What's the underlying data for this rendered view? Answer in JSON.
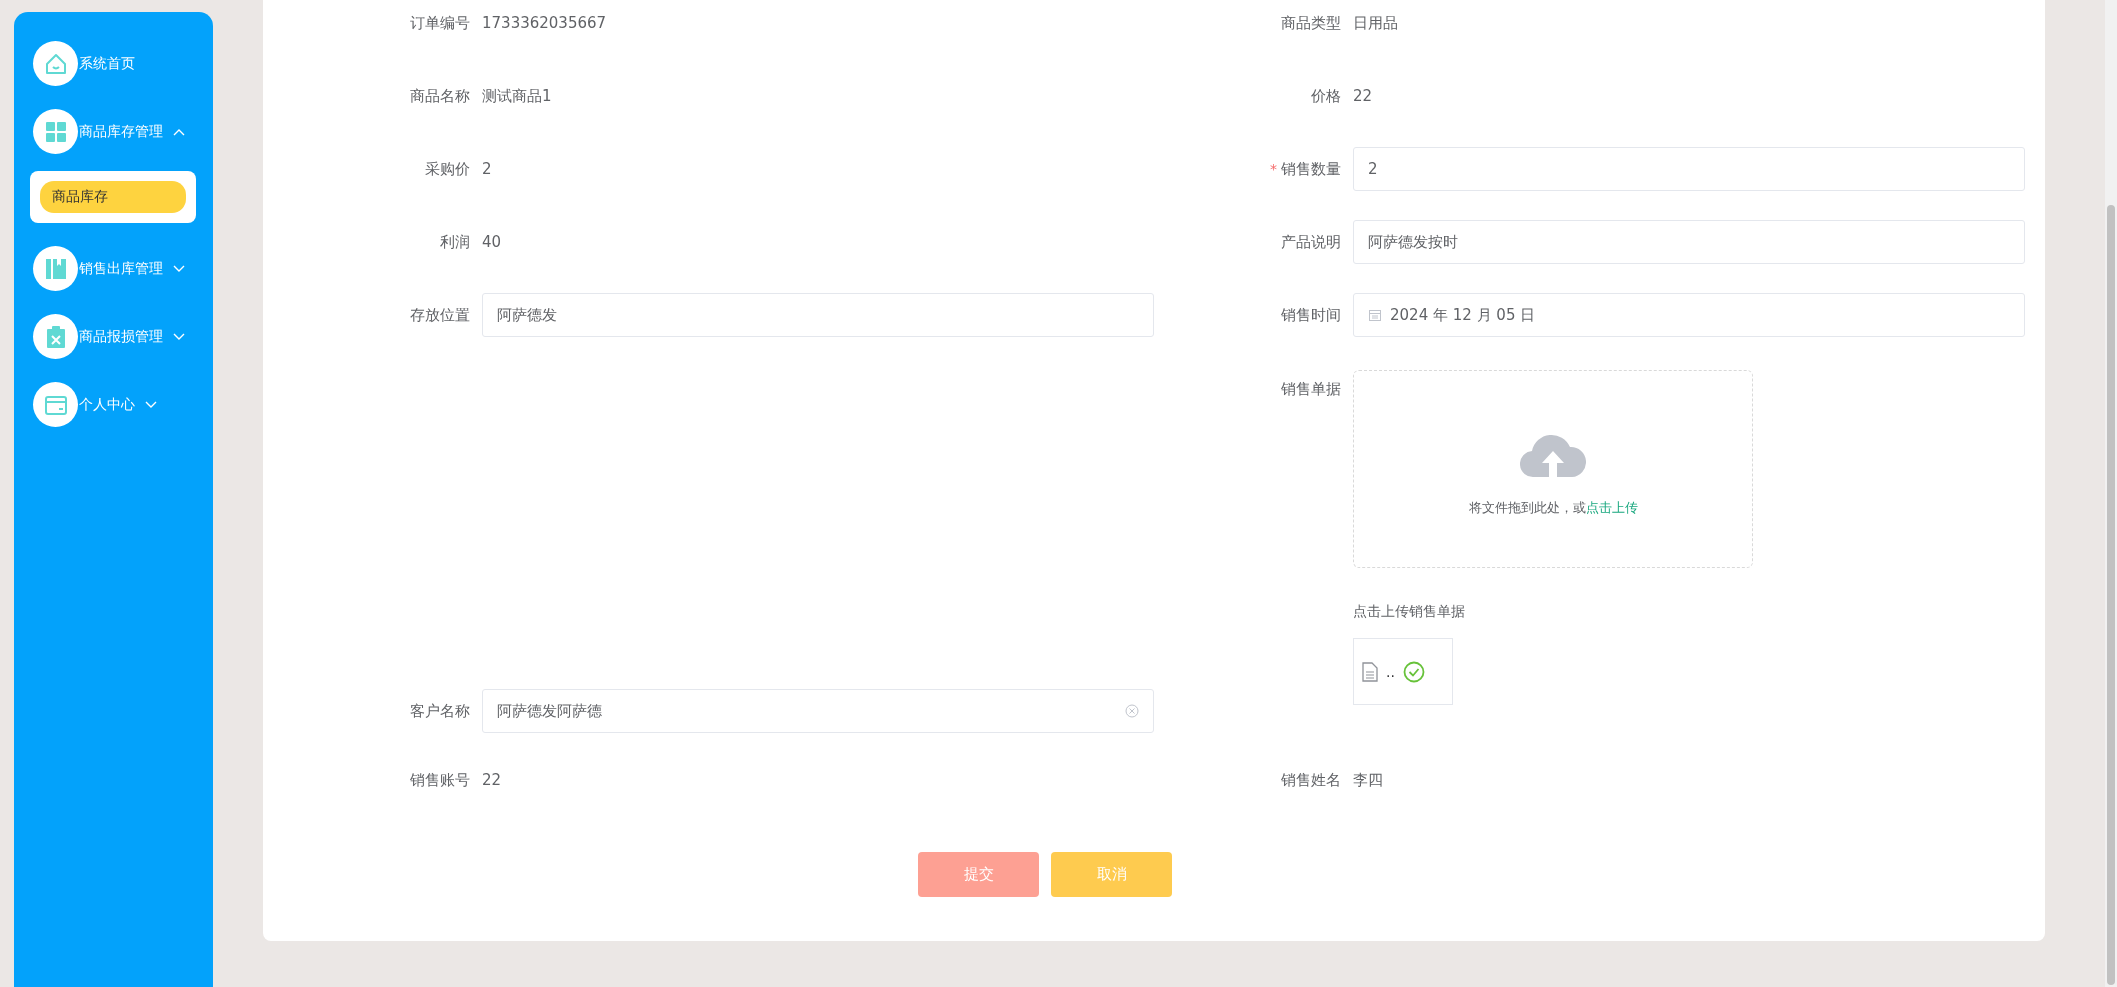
{
  "sidebar": {
    "items": [
      {
        "kind": "link",
        "label": "系统首页"
      },
      {
        "kind": "group",
        "label": "商品库存管理",
        "expanded": true,
        "children": [
          {
            "label": "商品库存",
            "selected": true
          }
        ]
      },
      {
        "kind": "group",
        "label": "销售出库管理",
        "expanded": false
      },
      {
        "kind": "group",
        "label": "商品报损管理",
        "expanded": false
      },
      {
        "kind": "group",
        "label": "个人中心",
        "expanded": false
      }
    ]
  },
  "form": {
    "rows": [
      [
        {
          "label": "订单编号",
          "kind": "text",
          "value": "1733362035667"
        },
        {
          "label": "商品类型",
          "kind": "text",
          "value": "日用品"
        }
      ],
      [
        {
          "label": "商品名称",
          "kind": "text",
          "value": "测试商品1"
        },
        {
          "label": "价格",
          "kind": "text",
          "value": "22"
        }
      ],
      [
        {
          "label": "采购价",
          "kind": "text",
          "value": "2"
        },
        {
          "label": "销售数量",
          "kind": "input",
          "value": "2",
          "required_mark": "*"
        }
      ],
      [
        {
          "label": "利润",
          "kind": "text",
          "value": "40"
        },
        {
          "label": "产品说明",
          "kind": "input",
          "value": "阿萨德发按时"
        }
      ],
      [
        {
          "label": "存放位置",
          "kind": "input",
          "value": "阿萨德发"
        },
        {
          "label": "销售时间",
          "kind": "date",
          "value": "2024 年 12 月 05 日"
        }
      ],
      [
        {
          "label": "客户名称",
          "kind": "input",
          "value": "阿萨德发阿萨德",
          "clearable": true
        },
        {
          "label": "销售单据",
          "kind": "upload",
          "prompt": "将文件拖到此处，或",
          "link": "点击上传",
          "tip": "点击上传销售单据",
          "files": [
            {
              "name": "..",
              "uploaded": true
            }
          ]
        }
      ],
      [
        {
          "label": "销售账号",
          "kind": "text",
          "value": "22"
        },
        {
          "label": "销售姓名",
          "kind": "text",
          "value": "李四"
        }
      ]
    ]
  },
  "buttons": [
    {
      "label": "提交",
      "kind": "submit"
    },
    {
      "label": "取消",
      "kind": "cancel"
    }
  ]
}
